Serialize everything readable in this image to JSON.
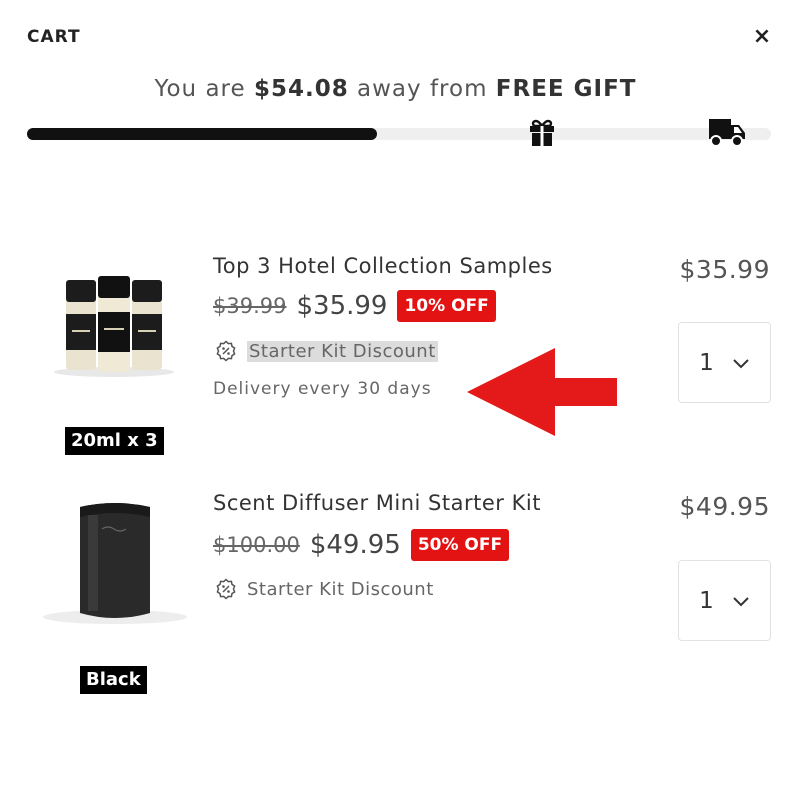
{
  "header": {
    "title": "CART",
    "close_label": "×"
  },
  "gift_bar": {
    "prefix": "You are",
    "amount": "$54.08",
    "middle": "away from",
    "goal": "FREE GIFT",
    "progress_fraction": 0.47
  },
  "items": [
    {
      "title": "Top 3 Hotel Collection Samples",
      "old_price": "$39.99",
      "new_price": "$35.99",
      "badge": "10% OFF",
      "discount_label": "Starter Kit Discount",
      "delivery": "Delivery every 30 days",
      "variant": "20ml x 3",
      "line_total": "$35.99",
      "quantity": "1"
    },
    {
      "title": "Scent Diffuser Mini Starter Kit",
      "old_price": "$100.00",
      "new_price": "$49.95",
      "badge": "50% OFF",
      "discount_label": "Starter Kit Discount",
      "variant": "Black",
      "line_total": "$49.95",
      "quantity": "1"
    }
  ],
  "colors": {
    "accent_red": "#e41313",
    "progress": "#111111",
    "track": "#efefef"
  }
}
